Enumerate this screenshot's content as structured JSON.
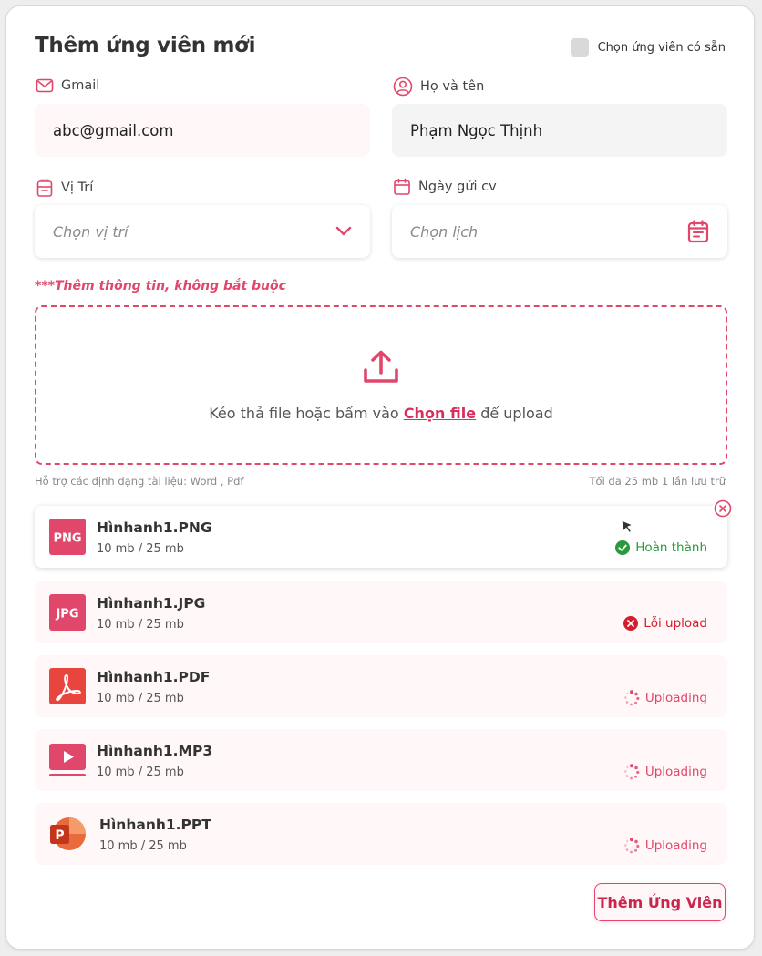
{
  "form": {
    "title": "Thêm ứng viên mới",
    "existing_label": "Chọn ứng viên có sẵn"
  },
  "fields": {
    "gmail": {
      "label": "Gmail",
      "value": "abc@gmail.com"
    },
    "fullname": {
      "label": "Họ và tên",
      "value": "Phạm Ngọc Thịnh"
    },
    "position": {
      "label": "Vị Trí",
      "placeholder": "Chọn vị trí"
    },
    "date": {
      "label": "Ngày gửi cv",
      "placeholder": "Chọn lịch"
    }
  },
  "optional_note": "***Thêm thông tin, không bắt buộc",
  "upload": {
    "text_before": "Kéo thả file hoặc bấm vào",
    "link": "Chọn file",
    "text_after": "để upload",
    "formats_hint": "Hỗ trợ các định dạng tài liệu: Word , Pdf",
    "limit_hint": "Tối đa 25 mb 1 lần lưu trữ"
  },
  "files": [
    {
      "name": "Hìnhanh1.PNG",
      "size": "10 mb / 25 mb",
      "status": "Hoàn thành",
      "badge": "PNG",
      "icon": "png-file-icon",
      "status_icon": "check-circle-icon"
    },
    {
      "name": "Hìnhanh1.JPG",
      "size": "10 mb / 25 mb",
      "status": "Lỗi upload",
      "badge": "JPG",
      "icon": "jpg-file-icon",
      "status_icon": "error-circle-icon"
    },
    {
      "name": "Hìnhanh1.PDF",
      "size": "10 mb / 25 mb",
      "status": "Uploading",
      "icon": "pdf-file-icon",
      "status_icon": "spinner-icon"
    },
    {
      "name": "Hìnhanh1.MP3",
      "size": "10 mb / 25 mb",
      "status": "Uploading",
      "icon": "media-file-icon",
      "status_icon": "spinner-icon"
    },
    {
      "name": "Hìnhanh1.PPT",
      "size": "10 mb / 25 mb",
      "status": "Uploading",
      "badge": "P",
      "icon": "powerpoint-file-icon",
      "status_icon": "spinner-icon"
    }
  ],
  "submit_label": "Thêm Ứng Viên",
  "colors": {
    "accent": "#e0476b",
    "accent_dark": "#d8305a",
    "success": "#2b9a3a",
    "error": "#d31f2d",
    "pdf": "#e9453f",
    "ppt": "#d64a22"
  }
}
